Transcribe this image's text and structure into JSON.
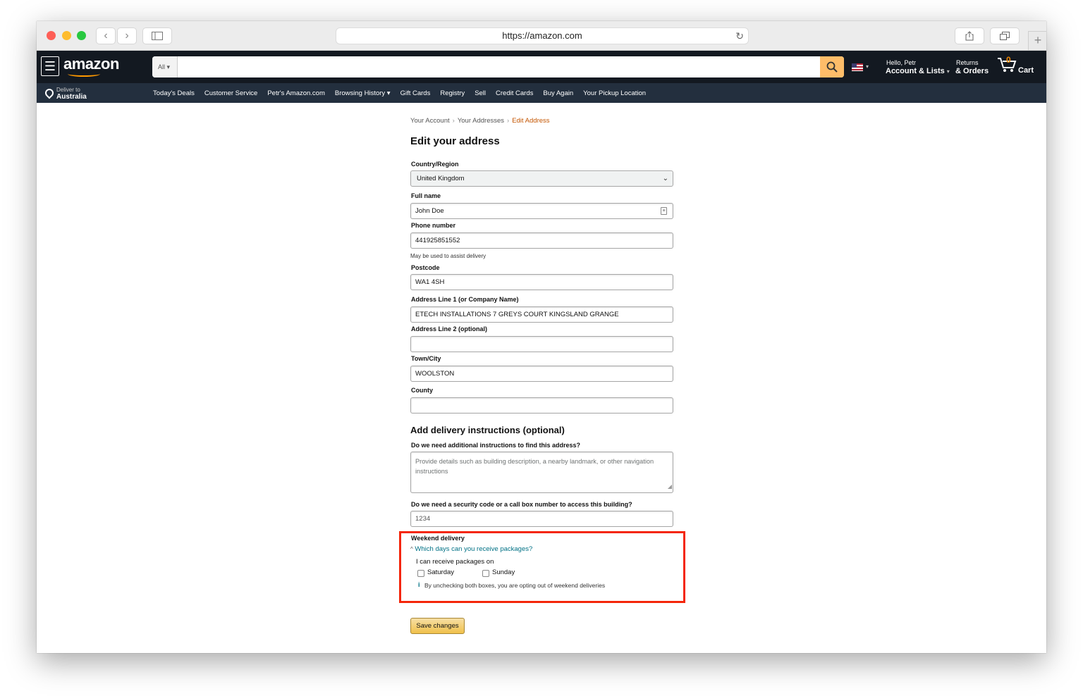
{
  "browser": {
    "url": "https://amazon.com"
  },
  "header": {
    "logo": "amazon",
    "search_category": "All",
    "greeting": "Hello, Petr",
    "account_label": "Account & Lists",
    "returns_line1": "Returns",
    "returns_line2": "& Orders",
    "cart_count": "0",
    "cart_label": "Cart"
  },
  "subnav": {
    "deliver_line1": "Deliver to",
    "deliver_line2": "Australia",
    "items": [
      "Today's Deals",
      "Customer Service",
      "Petr's Amazon.com",
      "Browsing History ▾",
      "Gift Cards",
      "Registry",
      "Sell",
      "Credit Cards",
      "Buy Again",
      "Your Pickup Location"
    ]
  },
  "breadcrumb": {
    "items": [
      "Your Account",
      "Your Addresses"
    ],
    "current": "Edit Address",
    "separator": "›"
  },
  "form": {
    "title": "Edit your address",
    "country_label": "Country/Region",
    "country_value": "United Kingdom",
    "fullname_label": "Full name",
    "fullname_value": "John Doe",
    "phone_label": "Phone number",
    "phone_value": "441925851552",
    "phone_hint": "May be used to assist delivery",
    "postcode_label": "Postcode",
    "postcode_value": "WA1 4SH",
    "address1_label": "Address Line 1 (or Company Name)",
    "address1_value": "ETECH INSTALLATIONS 7 GREYS COURT KINGSLAND GRANGE",
    "address2_label": "Address Line 2 (optional)",
    "address2_value": "",
    "town_label": "Town/City",
    "town_value": "WOOLSTON",
    "county_label": "County",
    "county_value": ""
  },
  "delivery": {
    "title": "Add delivery instructions (optional)",
    "find_label": "Do we need additional instructions to find this address?",
    "find_placeholder": "Provide details such as building description, a nearby landmark, or other navigation instructions",
    "security_label": "Do we need a security code or a call box number to access this building?",
    "security_value": "1234"
  },
  "weekend": {
    "title": "Weekend delivery",
    "link": "Which days can you receive packages?",
    "receive_text": "I can receive packages on",
    "saturday": "Saturday",
    "sunday": "Sunday",
    "info": "By unchecking both boxes, you are opting out of weekend deliveries"
  },
  "save_label": "Save changes",
  "colors": {
    "nav_dark": "#131921",
    "nav_sub": "#232f3e",
    "accent": "#ff9900",
    "link": "#007185",
    "highlight_box": "#f4260a"
  }
}
